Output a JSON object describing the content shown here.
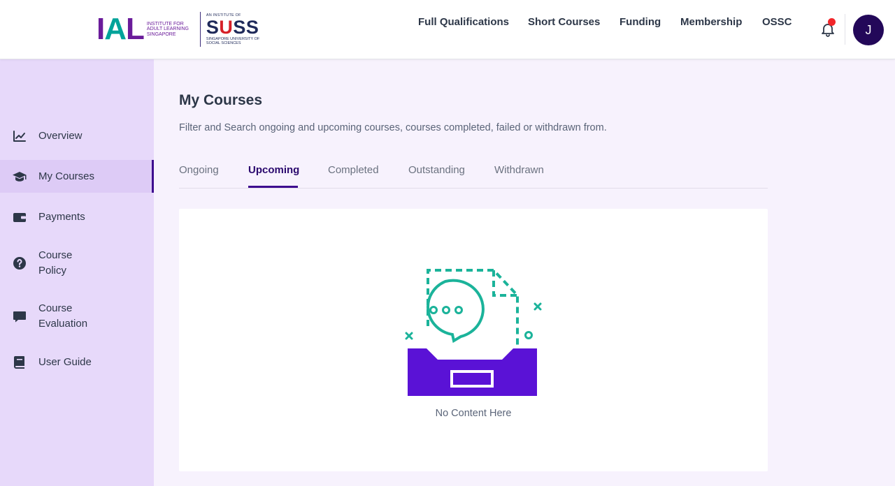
{
  "header": {
    "logo": {
      "ial_letters": "IAL",
      "ial_subtitle": "Institute for Adult Learning Singapore",
      "suss_top": "An Institute of",
      "suss_word_s1": "S",
      "suss_word_u": "U",
      "suss_word_ss": "SS",
      "suss_bottom": "Singapore University of Social Sciences"
    },
    "nav": [
      {
        "label": "Full Qualifications"
      },
      {
        "label": "Short Courses"
      },
      {
        "label": "Funding"
      },
      {
        "label": "Membership"
      },
      {
        "label": "OSSC"
      }
    ],
    "notification_icon": "bell-icon",
    "user_initial": "J",
    "colors": {
      "notification_dot": "#f2262a",
      "avatar_bg": "#230859"
    }
  },
  "sidebar": {
    "items": [
      {
        "label": "Overview",
        "icon": "line-chart-icon"
      },
      {
        "label": "My Courses",
        "icon": "graduation-cap-icon",
        "active": true
      },
      {
        "label": "Payments",
        "icon": "wallet-icon"
      },
      {
        "label": "Course\nPolicy",
        "icon": "question-circle-icon"
      },
      {
        "label": "Course\nEvaluation",
        "icon": "comment-icon"
      },
      {
        "label": "User Guide",
        "icon": "book-icon"
      }
    ],
    "colors": {
      "background": "#e7d9fa",
      "active_bg": "#ddcbf6",
      "active_border": "#3d0a8f"
    }
  },
  "main": {
    "title": "My Courses",
    "description": "Filter and Search ongoing and upcoming courses, courses completed, failed or withdrawn from.",
    "tabs": [
      {
        "label": "Ongoing"
      },
      {
        "label": "Upcoming",
        "active": true
      },
      {
        "label": "Completed"
      },
      {
        "label": "Outstanding"
      },
      {
        "label": "Withdrawn"
      }
    ],
    "empty_state": {
      "text": "No Content Here",
      "illustration": "empty-inbox-icon",
      "colors": {
        "tray": "#5a12d6",
        "accent": "#1bb39a"
      }
    }
  }
}
